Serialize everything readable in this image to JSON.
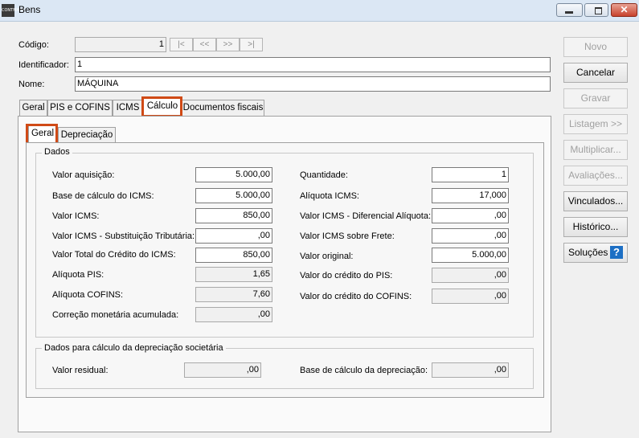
{
  "window": {
    "title": "Bens",
    "icon_text": "CONTMATIC"
  },
  "header": {
    "codigo_label": "Código:",
    "codigo_value": "1",
    "nav": [
      "|<",
      "<<",
      ">>",
      ">|"
    ],
    "identificador_label": "Identificador:",
    "identificador_value": "1",
    "nome_label": "Nome:",
    "nome_value": "MÁQUINA"
  },
  "tabs": [
    "Geral",
    "PIS e COFINS",
    "ICMS",
    "Cálculo",
    "Documentos fiscais"
  ],
  "active_tab": "Cálculo",
  "subtabs": [
    "Geral",
    "Depreciação"
  ],
  "active_subtab": "Geral",
  "dados": {
    "title": "Dados",
    "left": [
      {
        "label": "Valor aquisição:",
        "value": "5.000,00",
        "editable": true
      },
      {
        "label": "Base de cálculo do ICMS:",
        "value": "5.000,00",
        "editable": true
      },
      {
        "label": "Valor ICMS:",
        "value": "850,00",
        "editable": true
      },
      {
        "label": "Valor ICMS - Substituição Tributária:",
        "value": ",00",
        "editable": true
      },
      {
        "label": "Valor Total do Crédito do ICMS:",
        "value": "850,00",
        "editable": true
      },
      {
        "label": "Alíquota PIS:",
        "value": "1,65",
        "editable": false
      },
      {
        "label": "Alíquota COFINS:",
        "value": "7,60",
        "editable": false
      },
      {
        "label": "Correção monetária acumulada:",
        "value": ",00",
        "editable": false
      }
    ],
    "right": [
      {
        "label": "Quantidade:",
        "value": "1",
        "editable": true
      },
      {
        "label": "Alíquota ICMS:",
        "value": "17,000",
        "editable": true
      },
      {
        "label": "Valor ICMS - Diferencial Alíquota:",
        "value": ",00",
        "editable": true
      },
      {
        "label": "Valor ICMS sobre Frete:",
        "value": ",00",
        "editable": true
      },
      {
        "label": "Valor original:",
        "value": "5.000,00",
        "editable": true
      },
      {
        "label": "Valor do crédito do PIS:",
        "value": ",00",
        "editable": false
      },
      {
        "label": "Valor do crédito do COFINS:",
        "value": ",00",
        "editable": false
      }
    ]
  },
  "depreciacao": {
    "title": "Dados para cálculo da depreciação societária",
    "valor_residual_label": "Valor residual:",
    "valor_residual_value": ",00",
    "base_calculo_label": "Base de cálculo da depreciação:",
    "base_calculo_value": ",00"
  },
  "buttons": [
    {
      "label": "Novo",
      "enabled": false
    },
    {
      "label": "Cancelar",
      "enabled": true
    },
    {
      "label": "Gravar",
      "enabled": false
    },
    {
      "label": "Listagem >>",
      "enabled": false
    },
    {
      "label": "Multiplicar...",
      "enabled": false
    },
    {
      "label": "Avaliações...",
      "enabled": false
    },
    {
      "label": "Vinculados...",
      "enabled": true
    },
    {
      "label": "Histórico...",
      "enabled": true
    },
    {
      "label": "Soluções",
      "enabled": true,
      "help_icon": "?"
    }
  ],
  "colors": {
    "highlight": "#d04a16",
    "help_icon": "#1d6fc4"
  }
}
